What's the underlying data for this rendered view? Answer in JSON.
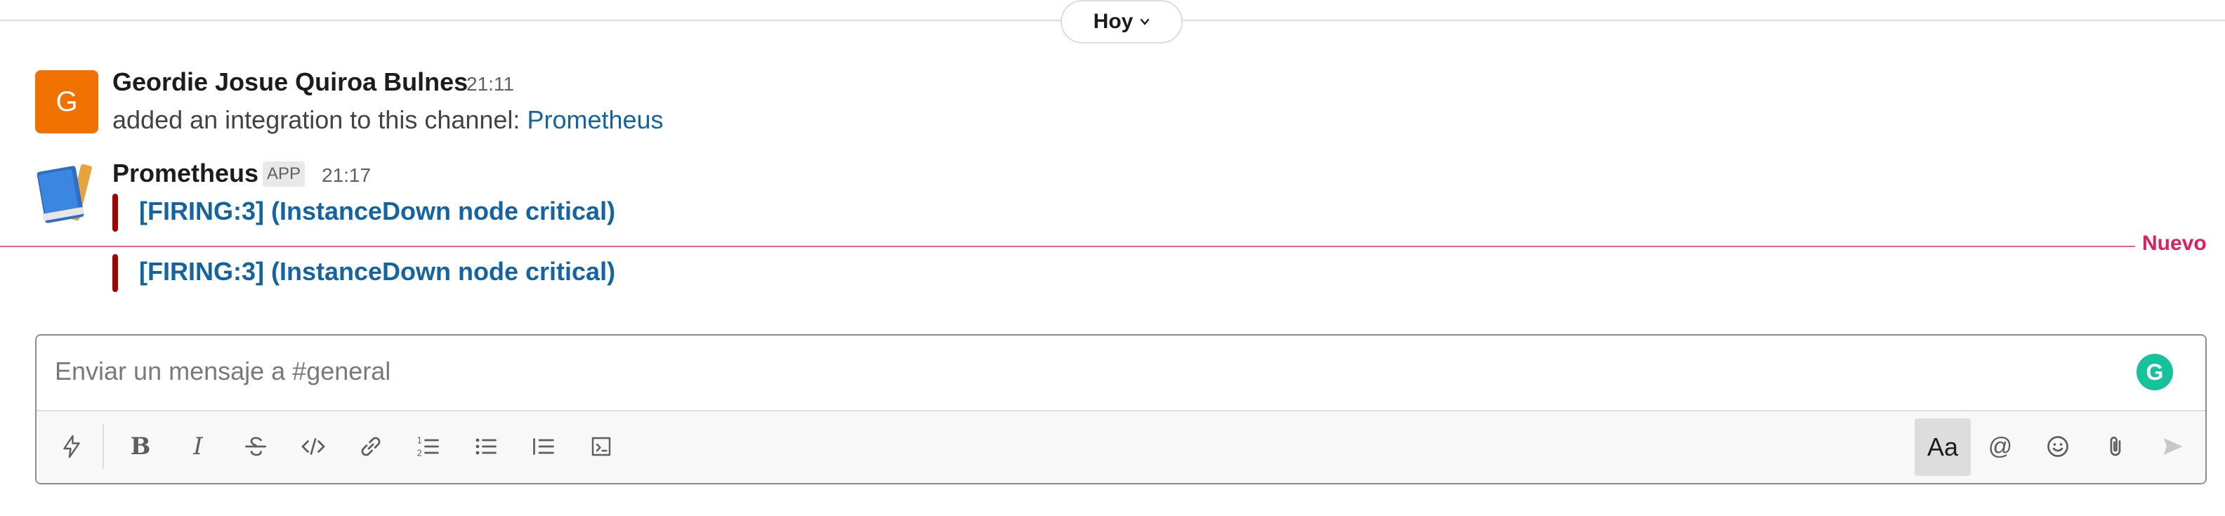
{
  "divider": {
    "label": "Hoy"
  },
  "messages": [
    {
      "author": "Geordie Josue Quiroa Bulnes",
      "avatar_letter": "G",
      "time": "21:11",
      "text": "added an integration to this channel: ",
      "link": "Prometheus"
    },
    {
      "author": "Prometheus",
      "badge": "APP",
      "time": "21:17",
      "attachments": [
        {
          "title": "[FIRING:3]  (InstanceDown node critical)"
        },
        {
          "title": "[FIRING:3]  (InstanceDown node critical)"
        }
      ]
    }
  ],
  "new_marker": {
    "label": "Nuevo"
  },
  "composer": {
    "placeholder": "Enviar un mensaje a #general",
    "grammarly_letter": "G",
    "aa_label": "Aa",
    "toolbar_icons": [
      "shortcuts-icon",
      "bold-icon",
      "italic-icon",
      "strikethrough-icon",
      "code-icon",
      "link-icon",
      "ordered-list-icon",
      "bulleted-list-icon",
      "blockquote-icon",
      "code-block-icon",
      "mention-icon",
      "emoji-icon",
      "attach-icon",
      "send-icon"
    ]
  },
  "colors": {
    "accent_link": "#1264a3",
    "new_red": "#e01e5a",
    "alert_bar": "#a30200",
    "avatar_orange": "#f07000"
  }
}
